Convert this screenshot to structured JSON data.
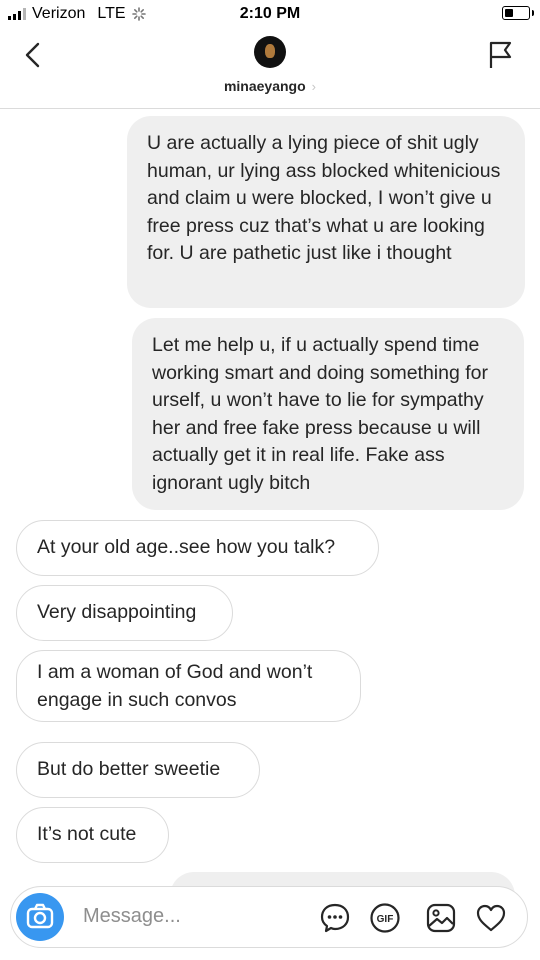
{
  "status_bar": {
    "carrier": "Verizon",
    "network": "LTE",
    "time": "2:10 PM",
    "battery_level": 0.35
  },
  "header": {
    "username": "minaeyango",
    "username_chevron": "›",
    "back_icon": "chevron-left-icon",
    "flag_icon": "flag-icon"
  },
  "messages": [
    {
      "direction": "outgoing",
      "text": "U are actually a lying piece of shit ugly human, ur lying ass blocked whitenicious and claim u were blocked, I won’t give u free press cuz that’s what u are looking for. U are pathetic just like i thought"
    },
    {
      "direction": "outgoing",
      "text": "Let me help u, if u actually spend time working smart and doing something for urself, u won’t have to lie for sympathy her and free fake press because u will actually get it in real life. Fake ass ignorant ugly bitch"
    },
    {
      "direction": "incoming",
      "text": "At your old age..see how you talk?"
    },
    {
      "direction": "incoming",
      "text": "Very disappointing"
    },
    {
      "direction": "incoming",
      "text": "I am a woman of God and won’t engage in such convos"
    },
    {
      "direction": "incoming",
      "text": "But do better sweetie"
    },
    {
      "direction": "incoming",
      "text": "It’s not cute"
    }
  ],
  "composer": {
    "placeholder": "Message...",
    "gif_label": "GIF",
    "icons": [
      "camera-icon",
      "chat-bubble-icon",
      "gif-icon",
      "image-icon",
      "heart-icon"
    ]
  },
  "colors": {
    "accent": "#3897f0",
    "outgoing_bubble": "#efefef",
    "border": "#dbdbdb",
    "placeholder_text": "#8e8e8e"
  }
}
